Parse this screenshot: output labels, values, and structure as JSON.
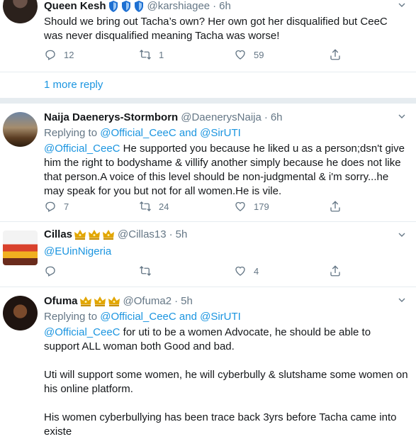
{
  "tweets": [
    {
      "name": "Queen Kesh",
      "handle": "@karshiagee",
      "dot": "·",
      "time": "6h",
      "text": "Should we bring out Tacha’s own? Her own got her disqualified but CeeC was never disqualified meaning Tacha was worse!",
      "replies": "12",
      "retweets": "1",
      "likes": "59"
    },
    {
      "name": "Naija Daenerys-Stormborn",
      "handle": "@DaenerysNaija",
      "dot": "·",
      "time": "6h",
      "replying_prefix": "Replying to",
      "replying_to_1": "@Official_CeeC",
      "replying_and": "and",
      "replying_to_2": "@SirUTI",
      "mention": "@Official_CeeC",
      "text": " He supported you because he liked u as a person;dsn't give him the right to bodyshame & villify another simply because he does not like that person.A voice of this level should be non-judgmental & i'm sorry...he may speak for you but not for all women.He is vile.",
      "replies": "7",
      "retweets": "24",
      "likes": "179"
    },
    {
      "name": "Cillas",
      "handle": "@Cillas13",
      "dot": "·",
      "time": "5h",
      "mention": "@EUinNigeria",
      "replies": "",
      "retweets": "",
      "likes": "4"
    },
    {
      "name": "Ofuma",
      "handle": "@Ofuma2",
      "dot": "·",
      "time": "5h",
      "replying_prefix": "Replying to",
      "replying_to_1": "@Official_CeeC",
      "replying_and": "and",
      "replying_to_2": "@SirUTI",
      "mention": "@Official_CeeC",
      "text": " for uti to be a women Advocate, he should be able to support ALL woman both Good and bad.\n\nUti will support some women, he will cyberbully & slutshame some women on his online platform.\n\nHis women cyberbullying has been trace back 3yrs before Tacha came into existe"
    }
  ],
  "more_replies": "1 more reply",
  "icons": {
    "reply": "reply-icon",
    "retweet": "retweet-icon",
    "like": "heart-icon",
    "share": "share-icon",
    "caret": "chevron-down-icon",
    "badge_shield": "blue-shield-emoji",
    "badge_crown": "gold-crown-emoji"
  },
  "colors": {
    "link": "#1b95e0",
    "muted": "#657786",
    "divider": "#e6ecf0"
  }
}
